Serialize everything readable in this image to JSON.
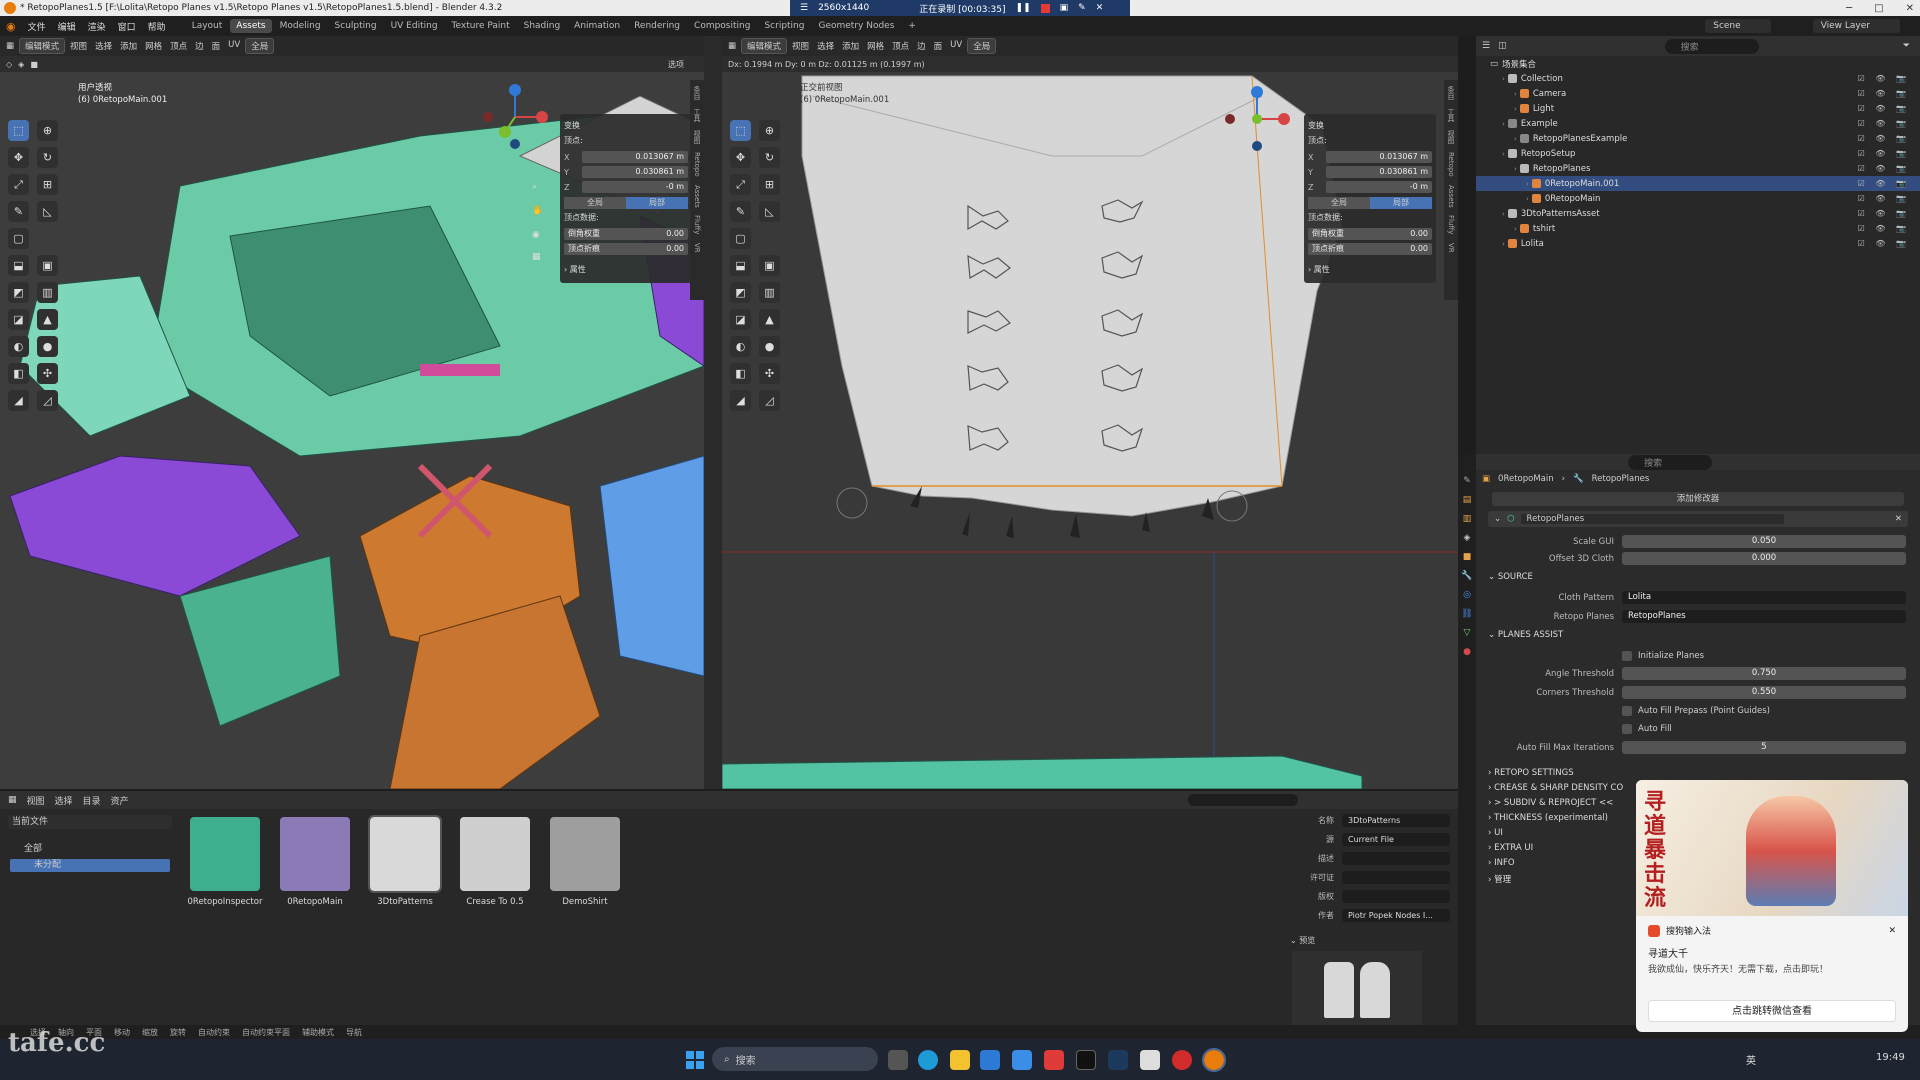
{
  "window": {
    "title": "* RetopoPlanes1.5 [F:\\Lolita\\Retopo Planes v1.5\\Retopo Planes v1.5\\RetopoPlanes1.5.blend] - Blender 4.3.2",
    "recording_resolution": "2560x1440",
    "recording_status": "正在录制 [00:03:35]"
  },
  "menus": [
    "文件",
    "编辑",
    "渲染",
    "窗口",
    "帮助"
  ],
  "workspaces": [
    "Layout",
    "Assets",
    "Modeling",
    "Sculpting",
    "UV Editing",
    "Texture Paint",
    "Shading",
    "Animation",
    "Rendering",
    "Compositing",
    "Scripting",
    "Geometry Nodes",
    "+"
  ],
  "active_workspace": "Assets",
  "scene": {
    "scene_name": "Scene",
    "view_layer": "View Layer"
  },
  "left_viewport": {
    "mode": "编辑模式",
    "menus": [
      "视图",
      "选择",
      "添加",
      "网格",
      "顶点",
      "边",
      "面",
      "UV"
    ],
    "orientation": "全局",
    "select_label": "选项",
    "view_name": "用户透视",
    "object_name": "(6) 0RetopoMain.001",
    "npanel": {
      "header": "变换",
      "vertex_label": "顶点:",
      "x": "0.013067 m",
      "y": "0.030861 m",
      "z": "-0 m",
      "global": "全局",
      "local": "局部",
      "vertex_data": "顶点数据:",
      "bevel_weight_label": "倒角权重",
      "bevel_weight": "0.00",
      "crease_label": "顶点折痕",
      "crease": "0.00",
      "attributes": "属性"
    },
    "side_tabs": [
      "条目",
      "工具",
      "视图",
      "Retopo",
      "Assets",
      "Fluffy",
      "VR"
    ]
  },
  "right_viewport": {
    "mode": "编辑模式",
    "menus": [
      "视图",
      "选择",
      "添加",
      "网格",
      "顶点",
      "边",
      "面",
      "UV"
    ],
    "orientation": "全局",
    "measure_text": "Dx: 0.1994 m  Dy: 0 m  Dz: 0.01125 m (0.1997 m)",
    "view_name": "正交前视图",
    "object_name": "(6) 0RetopoMain.001",
    "npanel": {
      "header": "变换",
      "vertex_label": "顶点:",
      "x": "0.013067 m",
      "y": "0.030861 m",
      "z": "-0 m",
      "global": "全局",
      "local": "局部",
      "vertex_data": "顶点数据:",
      "bevel_weight_label": "倒角权重",
      "bevel_weight": "0.00",
      "crease_label": "顶点折痕",
      "crease": "0.00",
      "attributes": "属性"
    }
  },
  "outliner": {
    "search_placeholder": "搜索",
    "root": "场景集合",
    "rows": [
      {
        "name": "Collection",
        "depth": 1,
        "color": "#bbbbbb"
      },
      {
        "name": "Camera",
        "depth": 2,
        "color": "#e1853e"
      },
      {
        "name": "Light",
        "depth": 2,
        "color": "#e1853e"
      },
      {
        "name": "Example",
        "depth": 1,
        "color": "#888888"
      },
      {
        "name": "RetopoPlanesExample",
        "depth": 2,
        "color": "#888888"
      },
      {
        "name": "RetopoSetup",
        "depth": 1,
        "color": "#bbbbbb"
      },
      {
        "name": "RetopoPlanes",
        "depth": 2,
        "color": "#bbbbbb"
      },
      {
        "name": "0RetopoMain.001",
        "depth": 3,
        "color": "#e1853e",
        "selected": true
      },
      {
        "name": "0RetopoMain",
        "depth": 3,
        "color": "#e1853e"
      },
      {
        "name": "3DtoPatternsAsset",
        "depth": 1,
        "color": "#bbbbbb"
      },
      {
        "name": "tshirt",
        "depth": 2,
        "color": "#e1853e"
      },
      {
        "name": "Lolita",
        "depth": 1,
        "color": "#e1853e"
      }
    ]
  },
  "properties": {
    "search_placeholder": "搜索",
    "breadcrumb_object": "0RetopoMain",
    "breadcrumb_modifier": "RetopoPlanes",
    "add_modifier": "添加修改器",
    "modifier_name": "RetopoPlanes",
    "scale_gui_label": "Scale GUI",
    "scale_gui": "0.050",
    "offset_label": "Offset 3D Cloth",
    "offset": "0.000",
    "source_label": "SOURCE",
    "cloth_pattern_label": "Cloth Pattern",
    "cloth_pattern": "Lolita",
    "retopo_planes_label": "Retopo Planes",
    "retopo_planes": "RetopoPlanes",
    "planes_assist_label": "PLANES ASSIST",
    "initialize_planes": "Initialize Planes",
    "angle_threshold_label": "Angle Threshold",
    "angle_threshold": "0.750",
    "corners_threshold_label": "Corners Threshold",
    "corners_threshold": "0.550",
    "auto_fill_prepass": "Auto Fill Prepass (Point Guides)",
    "auto_fill": "Auto Fill",
    "auto_fill_max_label": "Auto Fill Max Iterations",
    "auto_fill_max": "5",
    "collapsed_sections": [
      "RETOPO SETTINGS",
      "CREASE & SHARP DENSITY CO",
      "> SUBDIV & REPROJECT <<",
      "THICKNESS (experimental)",
      "UI",
      "EXTRA UI",
      "INFO",
      "管理"
    ]
  },
  "asset_browser": {
    "menus": [
      "视图",
      "选择",
      "目录",
      "资产"
    ],
    "library": "当前文件",
    "catalog_all": "全部",
    "catalog_unassigned": "未分配",
    "assets": [
      {
        "label": "0RetopoInspector",
        "color": "#3fae8f"
      },
      {
        "label": "0RetopoMain",
        "color": "#8c7ab7"
      },
      {
        "label": "3DtoPatterns",
        "color": "#d9d9d9"
      },
      {
        "label": "Crease To 0.5",
        "color": "#cfcfcf"
      },
      {
        "label": "DemoShirt",
        "color": "#9e9e9e"
      }
    ],
    "meta": {
      "name_label": "名称",
      "name": "3DtoPatterns",
      "source_label": "源",
      "source": "Current File",
      "desc_label": "描述",
      "license_label": "许可证",
      "copyright_label": "版权",
      "author_label": "作者",
      "author": "Piotr Popek Nodes I...",
      "preview_label": "预览"
    }
  },
  "statusbar": [
    "选择",
    "轴向",
    "平面",
    "移动",
    "缩放",
    "旋转",
    "自动约束",
    "自动约束平面",
    "辅助模式",
    "导航"
  ],
  "taskbar": {
    "search": "搜索",
    "lang": "英",
    "time": "19:49"
  },
  "toast": {
    "app": "搜狗输入法",
    "title": "寻道大千",
    "body": "我欲成仙，快乐齐天！无需下载，点击即玩！",
    "button": "点击跳转微信查看",
    "banner_text": "寻道暴击流"
  },
  "watermark": "tafe.cc"
}
